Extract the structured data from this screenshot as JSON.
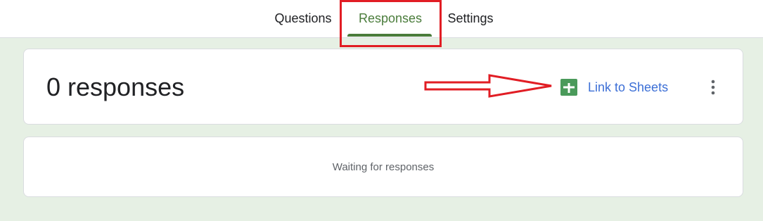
{
  "tabs": [
    {
      "label": "Questions",
      "active": false
    },
    {
      "label": "Responses",
      "active": true
    },
    {
      "label": "Settings",
      "active": false
    }
  ],
  "summary": {
    "response_count_text": "0 responses",
    "link_label": "Link to Sheets",
    "link_icon": "sheets-icon",
    "menu_icon": "more-vert-icon"
  },
  "waiting": {
    "text": "Waiting for responses"
  },
  "colors": {
    "accent_green": "#4a7c3b",
    "sheets_green": "#34a853",
    "link_blue": "#3c6fd6",
    "annotation_red": "#e11d24",
    "background": "#e6f0e4"
  }
}
